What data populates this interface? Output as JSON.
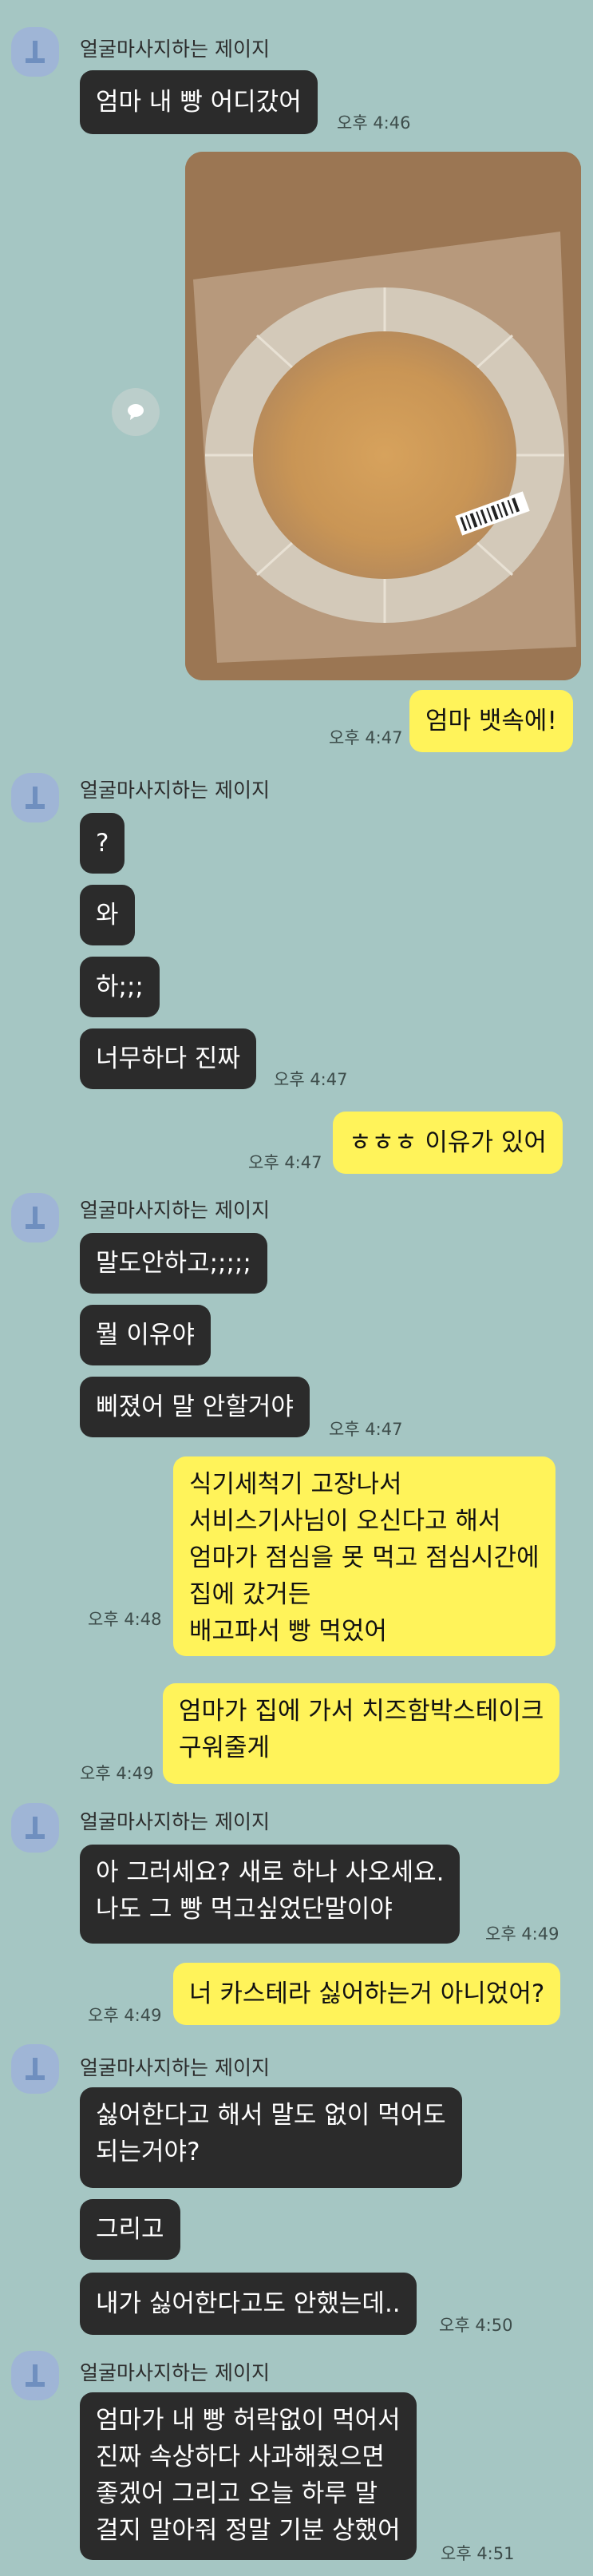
{
  "sender_name": "얼굴마사지하는 제이지",
  "messages": {
    "m1": "엄마 내 빵 어디갔어",
    "m2": "엄마 뱃속에!",
    "m3": "?",
    "m4": "와",
    "m5": "하;;;",
    "m6": "너무하다 진짜",
    "m7": "ㅎㅎㅎ 이유가 있어",
    "m8": "말도안하고;;;;;",
    "m9": "뭘 이유야",
    "m10": "삐졌어 말 안할거야",
    "m11": [
      "식기세척기 고장나서",
      "서비스기사님이 오신다고 해서",
      "엄마가 점심을 못 먹고 점심시간에",
      "집에 갔거든",
      "배고파서 빵 먹었어"
    ],
    "m12": [
      "엄마가 집에 가서 치즈함박스테이크",
      "구워줄게"
    ],
    "m13": [
      "아 그러세요? 새로 하나 사오세요.",
      "나도 그 빵 먹고싶었단말이야"
    ],
    "m14": "너 카스테라 싫어하는거 아니었어?",
    "m15": [
      "싫어한다고 해서 말도 없이 먹어도",
      "되는거야?"
    ],
    "m16": "그리고",
    "m17": "내가 싫어한다고도 안했는데..",
    "m18": [
      "엄마가 내 빵 허락없이 먹어서",
      "진짜 속상하다 사과해줬으면",
      "좋겠어 그리고 오늘 하루 말",
      "걸지 말아줘 정말 기분 상했어"
    ]
  },
  "times": {
    "t1": "오후 4:46",
    "t2": "오후 4:47",
    "t3": "오후 4:47",
    "t4": "오후 4:47",
    "t5": "오후 4:47",
    "t6": "오후 4:48",
    "t7": "오후 4:49",
    "t8": "오후 4:49",
    "t9": "오후 4:49",
    "t10": "오후 4:50",
    "t11": "오후 4:51"
  },
  "colors": {
    "background": "#a5c6c3",
    "incoming_bubble": "#2b2b2b",
    "outgoing_bubble": "#fff35a",
    "avatar": "#9fb5d6"
  },
  "icons": {
    "avatar": "default-profile-icon",
    "share": "speech-bubble-icon"
  },
  "photo": {
    "description_icon": "empty-cake-wrapper-photo"
  }
}
